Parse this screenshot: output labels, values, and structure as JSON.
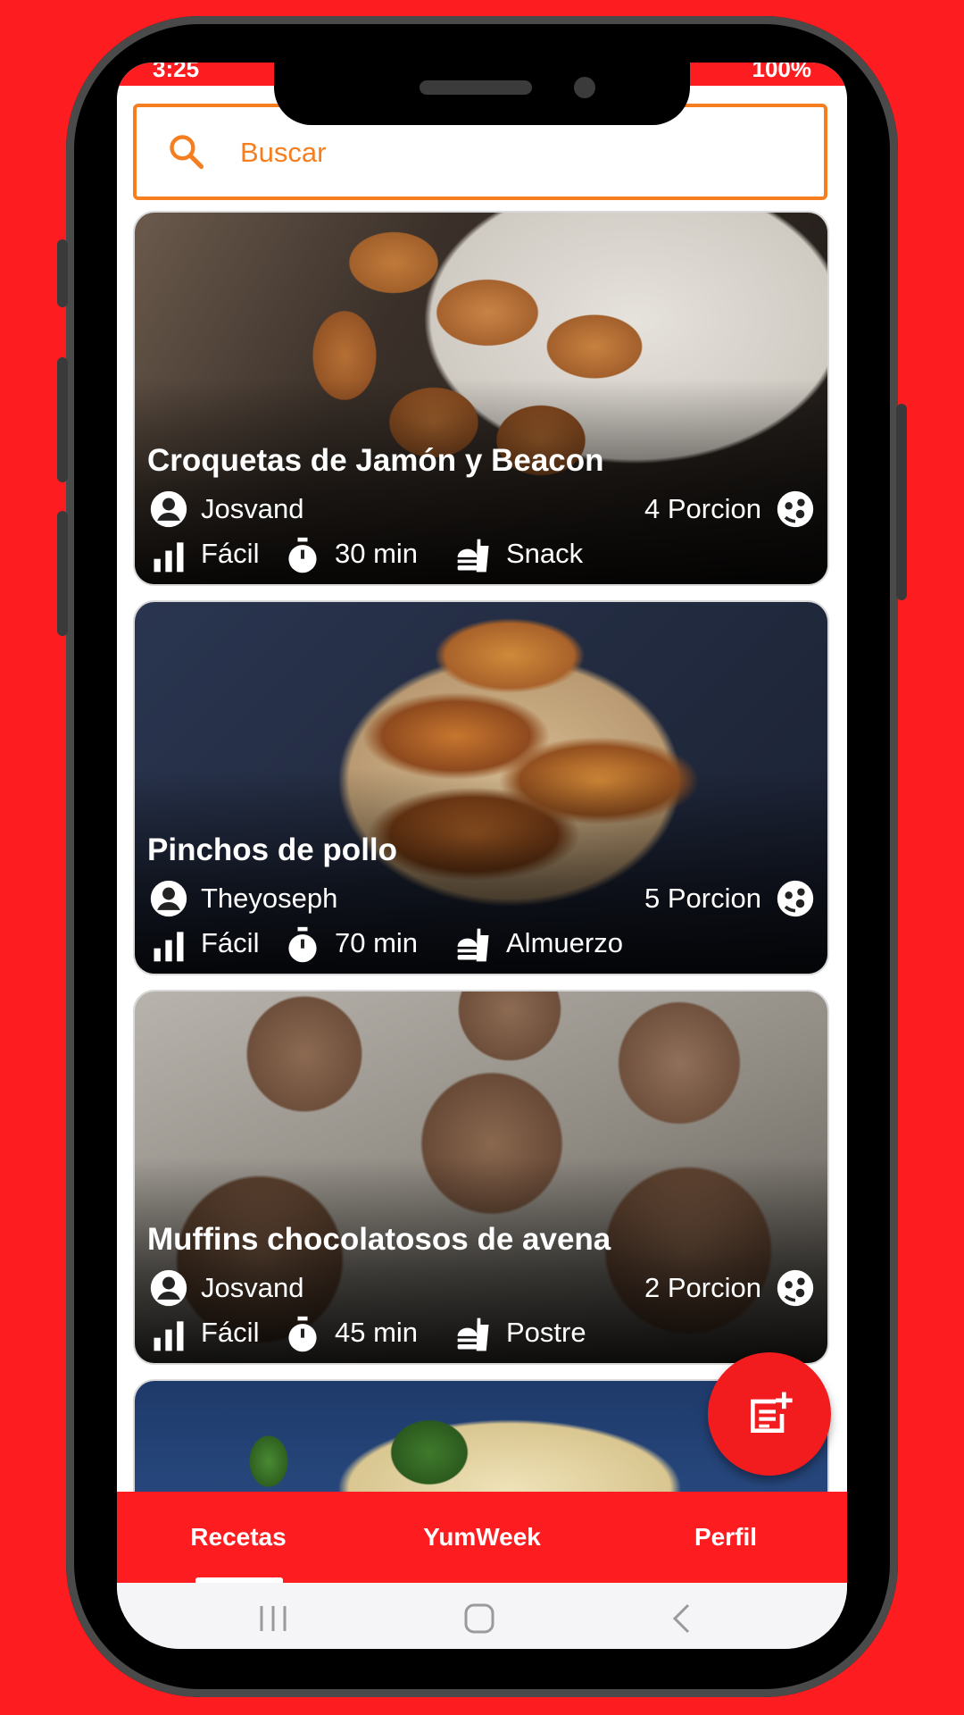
{
  "status_bar": {
    "time": "3:25",
    "battery": "100%"
  },
  "search": {
    "placeholder": "Buscar"
  },
  "recipes": [
    {
      "title": "Croquetas de Jamón y Beacon",
      "author": "Josvand",
      "portions": "4 Porcion",
      "difficulty": "Fácil",
      "time": "30 min",
      "category": "Snack"
    },
    {
      "title": "Pinchos de pollo",
      "author": "Theyoseph",
      "portions": "5 Porcion",
      "difficulty": "Fácil",
      "time": "70 min",
      "category": "Almuerzo"
    },
    {
      "title": "Muffins chocolatosos de avena",
      "author": "Josvand",
      "portions": "2 Porcion",
      "difficulty": "Fácil",
      "time": "45 min",
      "category": "Postre"
    }
  ],
  "bottom_nav": {
    "tabs": [
      "Recetas",
      "YumWeek",
      "Perfil"
    ],
    "active": "Recetas"
  },
  "colors": {
    "brand_red": "#fd1d20",
    "search_orange": "#f57f20"
  },
  "icons": [
    "search-icon",
    "person-icon",
    "difficulty-bars-icon",
    "timer-icon",
    "meal-category-icon",
    "portion-icon",
    "add-recipe-icon"
  ]
}
